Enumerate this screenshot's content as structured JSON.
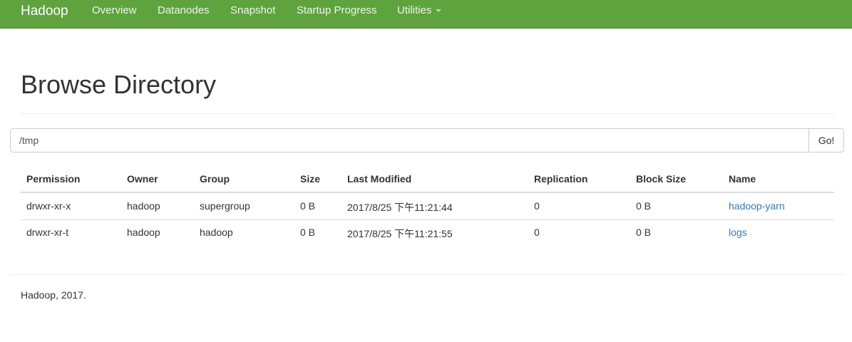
{
  "navbar": {
    "brand": "Hadoop",
    "items": [
      {
        "label": "Overview"
      },
      {
        "label": "Datanodes"
      },
      {
        "label": "Snapshot"
      },
      {
        "label": "Startup Progress"
      },
      {
        "label": "Utilities",
        "has_dropdown": true
      }
    ],
    "bg_color": "#5fa33e"
  },
  "page": {
    "title": "Browse Directory"
  },
  "path_bar": {
    "value": "/tmp",
    "go_label": "Go!"
  },
  "table": {
    "headers": [
      "Permission",
      "Owner",
      "Group",
      "Size",
      "Last Modified",
      "Replication",
      "Block Size",
      "Name"
    ],
    "rows": [
      [
        "drwxr-xr-x",
        "hadoop",
        "supergroup",
        "0 B",
        "2017/8/25 下午11:21:44",
        "0",
        "0 B",
        "hadoop-yarn"
      ],
      [
        "drwxr-xr-t",
        "hadoop",
        "hadoop",
        "0 B",
        "2017/8/25 下午11:21:55",
        "0",
        "0 B",
        "logs"
      ]
    ],
    "link_color": "#337ab7"
  },
  "footer": {
    "text": "Hadoop, 2017."
  }
}
